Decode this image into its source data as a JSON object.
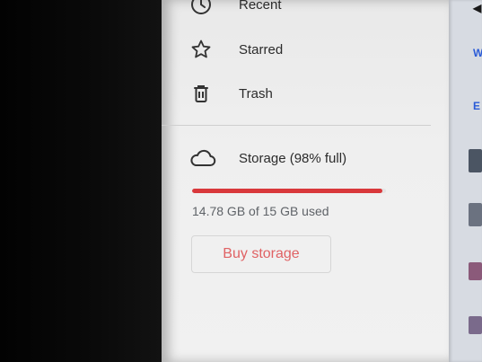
{
  "nav": {
    "items": [
      {
        "label": "Recent",
        "icon": "clock-icon"
      },
      {
        "label": "Starred",
        "icon": "star-icon"
      },
      {
        "label": "Trash",
        "icon": "trash-icon"
      }
    ]
  },
  "storage": {
    "label": "Storage (98% full)",
    "icon": "cloud-icon",
    "used_text": "14.78 GB of 15 GB used",
    "used_fraction": 0.98,
    "bar_color": "#d9383b",
    "buy_label": "Buy storage"
  },
  "right_strip": {
    "letters": [
      "W",
      "E"
    ]
  }
}
